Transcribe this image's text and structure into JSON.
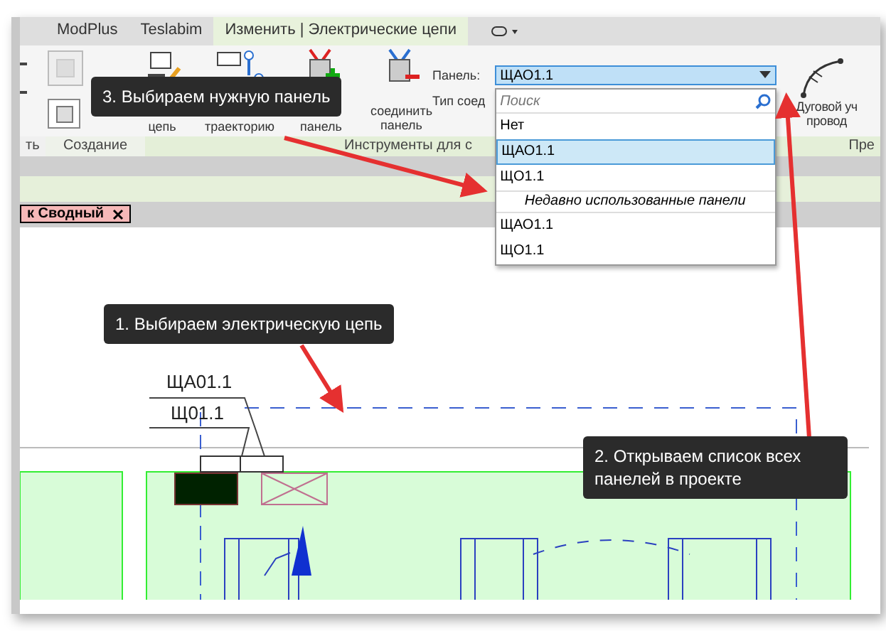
{
  "tabs": [
    {
      "label": "ModPlus",
      "selected": false
    },
    {
      "label": "Teslabim",
      "selected": false
    },
    {
      "label": "Изменить | Электрические цепи",
      "selected": true
    }
  ],
  "ribbon": {
    "groups": [
      {
        "label": "ть"
      },
      {
        "label": "Создание"
      },
      {
        "label": "Инструменты для с"
      },
      {
        "label": "Пре"
      }
    ],
    "tools": [
      {
        "kind": "edit",
        "lines": [
          "цепь"
        ]
      },
      {
        "kind": "path",
        "lines": [
          "траекторию"
        ]
      },
      {
        "kind": "add",
        "lines": [
          "панель"
        ]
      },
      {
        "kind": "remove",
        "lines": [
          "соединить",
          "панель"
        ]
      }
    ],
    "panel_combo": {
      "label": "Панель:",
      "value": "ЩАО1.1"
    },
    "connection_type": "Тип соед",
    "arc_tool": {
      "lines": [
        "Дуговой уч",
        "провод"
      ]
    }
  },
  "dropdown": {
    "search": {
      "placeholder": "Поиск"
    },
    "items": [
      {
        "kind": "item",
        "label": "Нет",
        "selected": false
      },
      {
        "kind": "item",
        "label": "ЩАО1.1",
        "selected": true
      },
      {
        "kind": "item",
        "label": "ЩО1.1",
        "selected": false
      },
      {
        "kind": "header",
        "label": "Недавно использованные панели",
        "selected": false
      },
      {
        "kind": "item",
        "label": "ЩАО1.1",
        "selected": false
      },
      {
        "kind": "item",
        "label": "ЩО1.1",
        "selected": false
      }
    ]
  },
  "document_tab": {
    "label": "к Сводный"
  },
  "drawing": {
    "tags": [
      "ЩА01.1",
      "Щ01.1"
    ]
  },
  "callouts": [
    {
      "text": "3. Выбираем нужную панель"
    },
    {
      "text": "1. Выбираем электрическую цепь"
    },
    {
      "text": "2. Открываем список всех панелей в проекте"
    }
  ]
}
